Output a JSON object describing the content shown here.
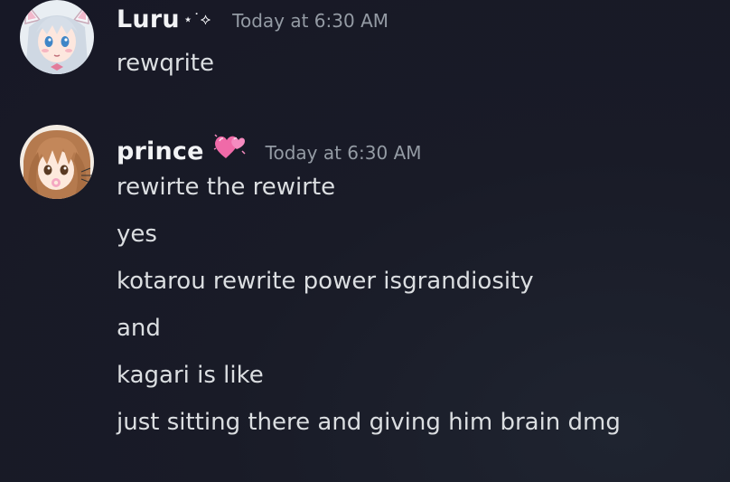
{
  "messages": [
    {
      "author": "Luru",
      "author_decoration": "⋆˙⟡",
      "timestamp": "Today at 6:30 AM",
      "lines": [
        "rewqrite"
      ]
    },
    {
      "author": "prince",
      "author_badge": "💞",
      "timestamp": "Today at 6:30 AM",
      "lines": [
        "rewirte the rewirte",
        "yes",
        "kotarou rewrite power isgrandiosity",
        "and",
        "kagari is like",
        "just sitting there and giving him brain dmg"
      ]
    }
  ],
  "icons": {
    "avatar_1": "anime-girl-cat-ears-avatar",
    "avatar_2": "anime-girl-brown-hair-avatar",
    "badge": "pink-hearts-icon"
  },
  "colors": {
    "background": "#191b27",
    "username": "#f2f3f5",
    "text": "#dbdee1",
    "timestamp": "#949ba4",
    "heart": "#f06aa8"
  }
}
